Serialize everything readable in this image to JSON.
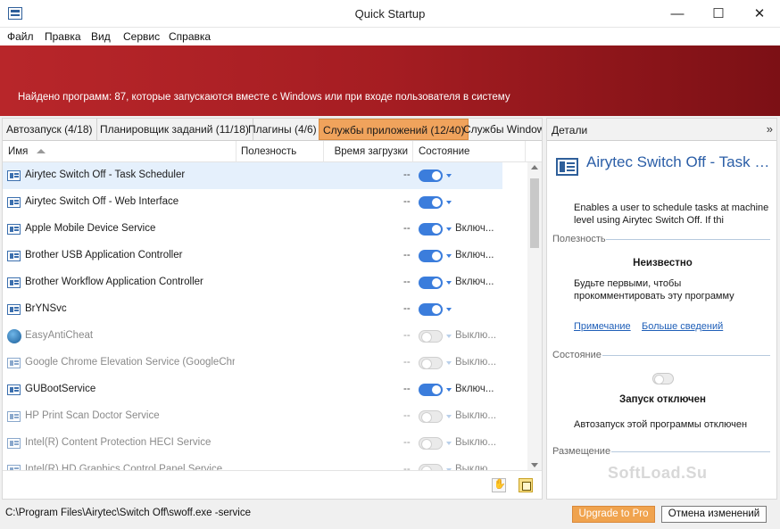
{
  "window": {
    "title": "Quick Startup",
    "minimize": "—",
    "maximize": "☐",
    "close": "✕"
  },
  "menu": [
    "Файл",
    "Правка",
    "Вид",
    "Сервис",
    "Справка"
  ],
  "banner": {
    "text": "Найдено программ: 87, которые запускаются вместе с Windows или при входе пользователя в систему"
  },
  "tabs": [
    {
      "label": "Автозапуск (4/18)",
      "active": false
    },
    {
      "label": "Планировщик заданий (11/18)",
      "active": false
    },
    {
      "label": "Плагины (4/6)",
      "active": false
    },
    {
      "label": "Службы приложений (12/40)",
      "active": true
    },
    {
      "label": "Службы Windows",
      "active": false
    }
  ],
  "columns": {
    "name": "Имя",
    "usefulness": "Полезность",
    "load_time": "Время загрузки",
    "state": "Состояние"
  },
  "rows": [
    {
      "name": "Airytec Switch Off - Task Scheduler",
      "load": "--",
      "enabled": true,
      "state": "",
      "selected": true,
      "icon": "service-icon",
      "dim": false
    },
    {
      "name": "Airytec Switch Off - Web Interface",
      "load": "--",
      "enabled": true,
      "state": "",
      "selected": false,
      "icon": "service-icon",
      "dim": false
    },
    {
      "name": "Apple Mobile Device Service",
      "load": "--",
      "enabled": true,
      "state": "Включ...",
      "selected": false,
      "icon": "service-icon",
      "dim": false
    },
    {
      "name": "Brother USB Application Controller",
      "load": "--",
      "enabled": true,
      "state": "Включ...",
      "selected": false,
      "icon": "service-icon",
      "dim": false
    },
    {
      "name": "Brother Workflow Application Controller",
      "load": "--",
      "enabled": true,
      "state": "Включ...",
      "selected": false,
      "icon": "service-icon",
      "dim": false
    },
    {
      "name": "BrYNSvc",
      "load": "--",
      "enabled": true,
      "state": "",
      "selected": false,
      "icon": "service-icon",
      "dim": false
    },
    {
      "name": "EasyAntiCheat",
      "load": "--",
      "enabled": false,
      "state": "Выклю...",
      "selected": false,
      "icon": "shield-icon",
      "dim": true
    },
    {
      "name": "Google Chrome Elevation Service (GoogleChr...",
      "load": "--",
      "enabled": false,
      "state": "Выклю...",
      "selected": false,
      "icon": "service-icon",
      "dim": true
    },
    {
      "name": "GUBootService",
      "load": "--",
      "enabled": true,
      "state": "Включ...",
      "selected": false,
      "icon": "service-icon",
      "dim": false
    },
    {
      "name": "HP Print Scan Doctor Service",
      "load": "--",
      "enabled": false,
      "state": "Выклю...",
      "selected": false,
      "icon": "service-icon",
      "dim": true
    },
    {
      "name": "Intel(R) Content Protection HECI Service",
      "load": "--",
      "enabled": false,
      "state": "Выклю...",
      "selected": false,
      "icon": "service-icon",
      "dim": true
    },
    {
      "name": "Intel(R) HD Graphics Control Panel Service",
      "load": "--",
      "enabled": false,
      "state": "Выклю...",
      "selected": false,
      "icon": "service-icon",
      "dim": true
    }
  ],
  "details": {
    "header": "Детали",
    "collapse_icon": "»",
    "title": "Airytec Switch Off - Task Scheduler",
    "description": "Enables a user to schedule tasks at machine level using Airytec Switch Off. If thi",
    "usefulness_section": "Полезность",
    "usefulness_value": "Неизвестно",
    "usefulness_note": "Будьте первыми, чтобы прокомментировать эту программу",
    "link_note": "Примечание",
    "link_more": "Больше сведений",
    "state_section": "Состояние",
    "state_value": "Запуск отключен",
    "state_note": "Автозапуск этой программы отключен",
    "placement_section": "Размещение",
    "watermark": "SoftLoad.Su"
  },
  "status": {
    "path": "C:\\Program Files\\Airytec\\Switch Off\\swoff.exe -service",
    "upgrade_button": "Upgrade to Pro",
    "cancel_button": "Отмена изменений"
  },
  "colors": {
    "banner": "#a51d22",
    "accent": "#3b7ddc",
    "active_tab": "#f0a35c",
    "upgrade": "#f0a34e",
    "link": "#1f5fb8"
  }
}
